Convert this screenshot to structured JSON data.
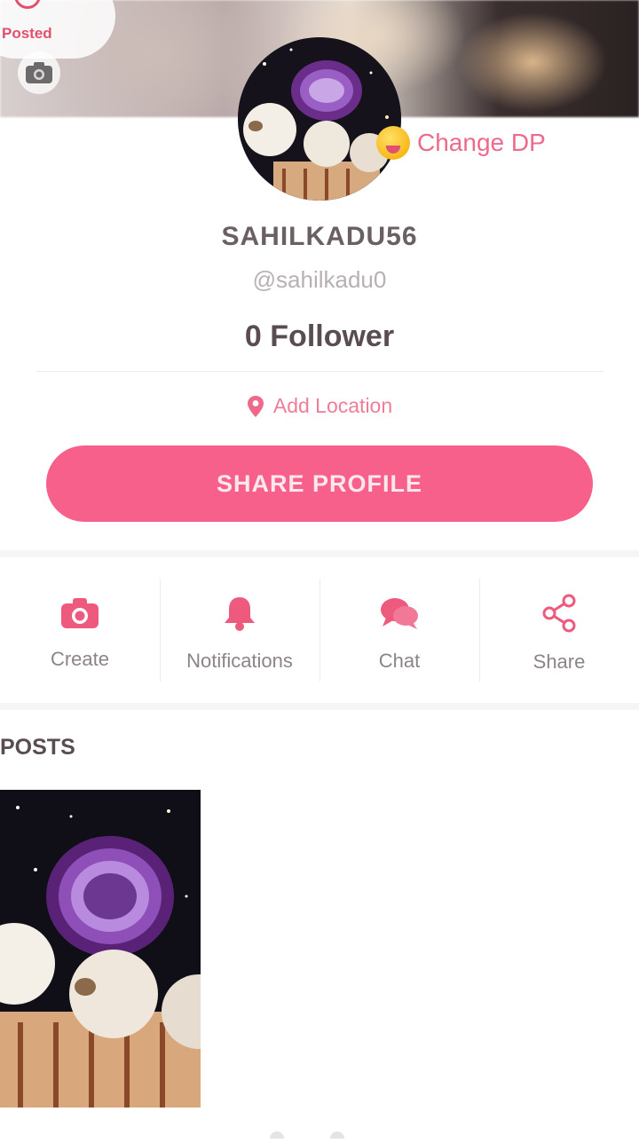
{
  "header": {
    "posted_label": "Posted",
    "change_dp_label": "Change DP"
  },
  "profile": {
    "display_name": "SAHILKADU56",
    "handle": "@sahilkadu0",
    "followers": "0 Follower",
    "location_label": "Add Location",
    "share_button_label": "SHARE PROFILE"
  },
  "actions": [
    {
      "label": "Create",
      "icon": "camera-icon"
    },
    {
      "label": "Notifications",
      "icon": "bell-icon"
    },
    {
      "label": "Chat",
      "icon": "chat-bubbles-icon"
    },
    {
      "label": "Share",
      "icon": "share-icon"
    }
  ],
  "posts": {
    "section_title": "POSTS"
  },
  "colors": {
    "accent": "#f7608a",
    "accent_text": "#ee6a8c",
    "icon": "#ee5a7e"
  }
}
